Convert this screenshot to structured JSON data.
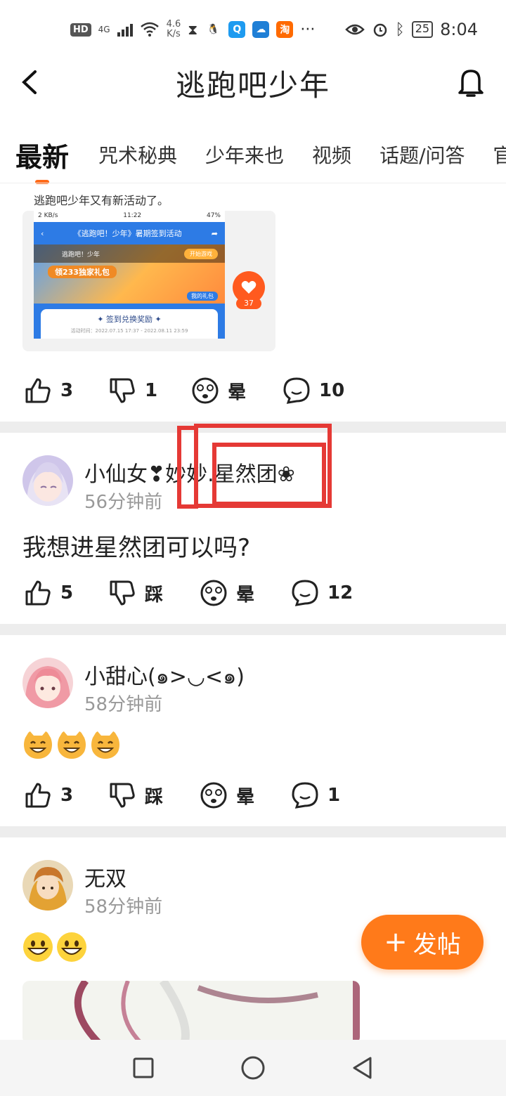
{
  "status_bar": {
    "left_badge": "HD",
    "signal_label": "4G",
    "net_speed_value": "4.6",
    "net_speed_unit": "K/s",
    "battery": "25",
    "time": "8:04"
  },
  "header": {
    "title": "逃跑吧少年"
  },
  "tabs": [
    "最新",
    "咒术秘典",
    "少年来也",
    "视频",
    "话题/问答",
    "官"
  ],
  "post1": {
    "caption": "逃跑吧少年又有新活动了。",
    "shot": {
      "status_left": "2 KB/s",
      "status_time": "11:22",
      "status_right": "47%",
      "title": "《逃跑吧！少年》暑期签到活动",
      "player": "逃跑吧！少年",
      "start_button": "开始游戏",
      "gift": "领233独家礼包",
      "my_gift": "我的礼包",
      "card_title": "✦ 签到兑换奖励 ✦",
      "card_date": "活动时间：2022.07.15 17:37 - 2022.08.11 23:59"
    },
    "like_badge_count": "37",
    "actions": {
      "like": "3",
      "dislike": "1",
      "dizzy": "晕",
      "comment": "10"
    }
  },
  "post2": {
    "user": "小仙女❣妙妙.星然团❀",
    "time": "56分钟前",
    "text": "我想进星然团可以吗?",
    "actions": {
      "like": "5",
      "dislike": "踩",
      "dizzy": "晕",
      "comment": "12"
    }
  },
  "post3": {
    "user": "小甜心(๑>◡<๑)",
    "time": "58分钟前",
    "actions": {
      "like": "3",
      "dislike": "踩",
      "dizzy": "晕",
      "comment": "1"
    }
  },
  "post4": {
    "user": "无双",
    "time": "58分钟前"
  },
  "fab": {
    "label": "发帖",
    "plus": "+"
  },
  "colors": {
    "accent": "#ff7a1a",
    "highlight": "#e53935"
  }
}
